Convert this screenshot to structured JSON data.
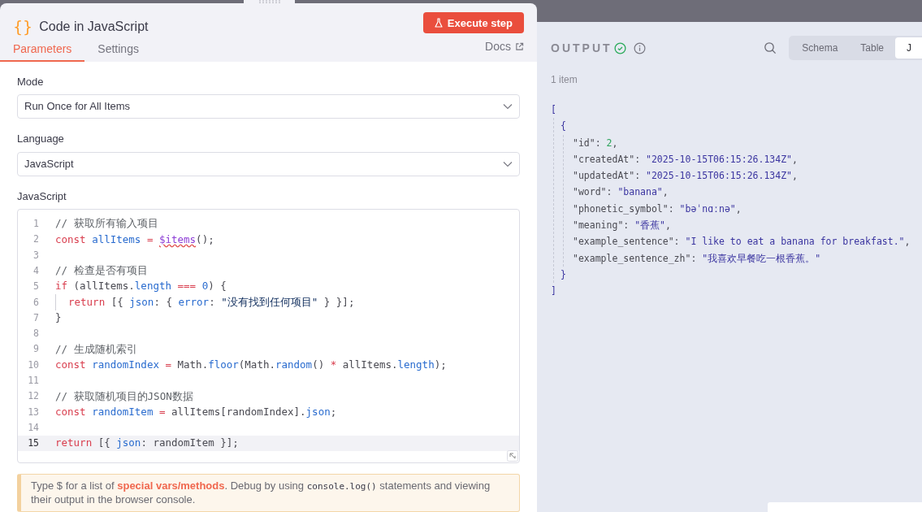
{
  "node": {
    "icon": "{}",
    "title": "Code in JavaScript",
    "execute_button": "Execute step"
  },
  "tabs": [
    {
      "label": "Parameters",
      "selected": true
    },
    {
      "label": "Settings",
      "selected": false
    }
  ],
  "docs_link": "Docs",
  "fields": [
    {
      "label": "Mode",
      "value": "Run Once for All Items"
    },
    {
      "label": "Language",
      "value": "JavaScript"
    }
  ],
  "editor": {
    "label": "JavaScript",
    "lines": [
      {
        "number": "1",
        "selected": false,
        "tokens": [
          {
            "text": "// 获取所有输入项目",
            "kind": "comment"
          }
        ]
      },
      {
        "number": "2",
        "selected": false,
        "tokens": [
          {
            "text": "const ",
            "kind": "keyword"
          },
          {
            "text": "allItems",
            "kind": "variable"
          },
          {
            "text": " = ",
            "kind": "keyword"
          },
          {
            "text": "$items",
            "kind": "special"
          },
          {
            "text": "();",
            "kind": "plain"
          }
        ]
      },
      {
        "number": "3",
        "selected": false
      },
      {
        "number": "4",
        "selected": false,
        "tokens": [
          {
            "text": "// 检查是否有项目",
            "kind": "comment"
          }
        ]
      },
      {
        "number": "5",
        "selected": false,
        "tokens": [
          {
            "text": "if ",
            "kind": "keyword"
          },
          {
            "text": "(allItems.",
            "kind": "plain"
          },
          {
            "text": "length",
            "kind": "variable"
          },
          {
            "text": " === ",
            "kind": "keyword"
          },
          {
            "text": "0",
            "kind": "number"
          },
          {
            "text": ") {",
            "kind": "plain"
          }
        ]
      },
      {
        "number": "6",
        "selected": false,
        "indented": true,
        "tokens": [
          {
            "text": "return ",
            "kind": "keyword"
          },
          {
            "text": "[{ ",
            "kind": "plain"
          },
          {
            "text": "json",
            "kind": "variable"
          },
          {
            "text": ": { ",
            "kind": "plain"
          },
          {
            "text": "error",
            "kind": "variable"
          },
          {
            "text": ": ",
            "kind": "plain"
          },
          {
            "text": "\"没有找到任何项目\"",
            "kind": "string"
          },
          {
            "text": " } }];",
            "kind": "plain"
          }
        ]
      },
      {
        "number": "7",
        "selected": false,
        "tokens": [
          {
            "text": "}",
            "kind": "plain"
          }
        ]
      },
      {
        "number": "8",
        "selected": false
      },
      {
        "number": "9",
        "selected": false,
        "tokens": [
          {
            "text": "// 生成随机索引",
            "kind": "comment"
          }
        ]
      },
      {
        "number": "10",
        "selected": false,
        "tokens": [
          {
            "text": "const ",
            "kind": "keyword"
          },
          {
            "text": "randomIndex",
            "kind": "variable"
          },
          {
            "text": " = ",
            "kind": "keyword"
          },
          {
            "text": "Math.",
            "kind": "plain"
          },
          {
            "text": "floor",
            "kind": "variable"
          },
          {
            "text": "(Math.",
            "kind": "plain"
          },
          {
            "text": "random",
            "kind": "variable"
          },
          {
            "text": "() ",
            "kind": "plain"
          },
          {
            "text": "*",
            "kind": "keyword"
          },
          {
            "text": " allItems.",
            "kind": "plain"
          },
          {
            "text": "length",
            "kind": "variable"
          },
          {
            "text": ");",
            "kind": "plain"
          }
        ]
      },
      {
        "number": "11",
        "selected": false
      },
      {
        "number": "12",
        "selected": false,
        "tokens": [
          {
            "text": "// 获取随机项目的JSON数据",
            "kind": "comment"
          }
        ]
      },
      {
        "number": "13",
        "selected": false,
        "tokens": [
          {
            "text": "const ",
            "kind": "keyword"
          },
          {
            "text": "randomItem",
            "kind": "variable"
          },
          {
            "text": " = ",
            "kind": "keyword"
          },
          {
            "text": "allItems[randomIndex].",
            "kind": "plain"
          },
          {
            "text": "json",
            "kind": "variable"
          },
          {
            "text": ";",
            "kind": "plain"
          }
        ]
      },
      {
        "number": "14",
        "selected": false
      },
      {
        "number": "15",
        "selected": true,
        "tokens": [
          {
            "text": "return ",
            "kind": "keyword"
          },
          {
            "text": "[{ ",
            "kind": "plain"
          },
          {
            "text": "json",
            "kind": "variable"
          },
          {
            "text": ": randomItem }];",
            "kind": "plain"
          }
        ]
      }
    ]
  },
  "hint": [
    {
      "text": "Type $ for a list of ",
      "kind": "text"
    },
    {
      "text": "special vars/methods",
      "kind": "link"
    },
    {
      "text": ". Debug by using ",
      "kind": "text"
    },
    {
      "text": "console.log()",
      "kind": "code"
    },
    {
      "text": " statements and viewing their output in the browser console.",
      "kind": "text"
    }
  ],
  "output": {
    "title": "OUTPUT",
    "view_tabs": [
      {
        "label": "Schema",
        "selected": false
      },
      {
        "label": "Table",
        "selected": false
      },
      {
        "label": "J",
        "selected": true
      }
    ],
    "count": "1 item",
    "json": {
      "open": "[",
      "close": "]",
      "children": [
        {
          "open": "{",
          "close": "}",
          "fields": [
            {
              "key": "\"id\":",
              "value": "2",
              "kind": "number",
              "sep": ","
            },
            {
              "key": "\"createdAt\":",
              "value": "\"2025-10-15T06:15:26.134Z\"",
              "kind": "string",
              "sep": ","
            },
            {
              "key": "\"updatedAt\":",
              "value": "\"2025-10-15T06:15:26.134Z\"",
              "kind": "string",
              "sep": ","
            },
            {
              "key": "\"word\":",
              "value": "\"banana\"",
              "kind": "string",
              "sep": ","
            },
            {
              "key": "\"phonetic_symbol\":",
              "value": "\"bəˈnɑːnə\"",
              "kind": "string",
              "sep": ","
            },
            {
              "key": "\"meaning\":",
              "value": "\"香蕉\"",
              "kind": "string",
              "sep": ","
            },
            {
              "key": "\"example_sentence\":",
              "value": "\"I like to eat a banana for breakfast.\"",
              "kind": "string",
              "sep": ","
            },
            {
              "key": "\"example_sentence_zh\":",
              "value": "\"我喜欢早餐吃一根香蕉。\"",
              "kind": "string"
            }
          ]
        }
      ]
    }
  }
}
